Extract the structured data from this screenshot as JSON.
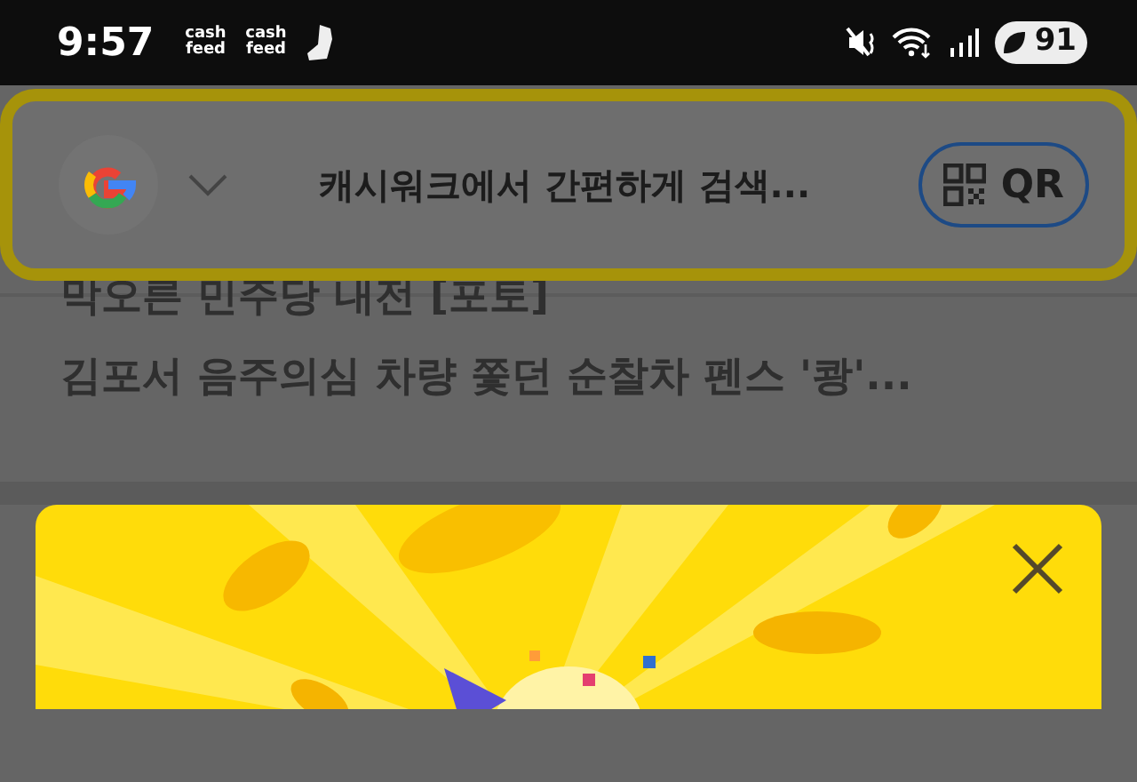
{
  "status_bar": {
    "time": "9:57",
    "notifications": [
      {
        "kind": "logo",
        "text": "cash feed"
      },
      {
        "kind": "logo",
        "text": "cash feed"
      },
      {
        "kind": "shoe"
      }
    ],
    "battery": "91"
  },
  "search_bar": {
    "placeholder": "캐시워크에서 간편하게 검색...",
    "qr_button": "QR"
  },
  "news": [
    {
      "title": "막오른 민주당 내전 [포토]"
    },
    {
      "title": "김포서 음주의심 차량 쫓던 순찰차 펜스 '쾅'..."
    }
  ]
}
